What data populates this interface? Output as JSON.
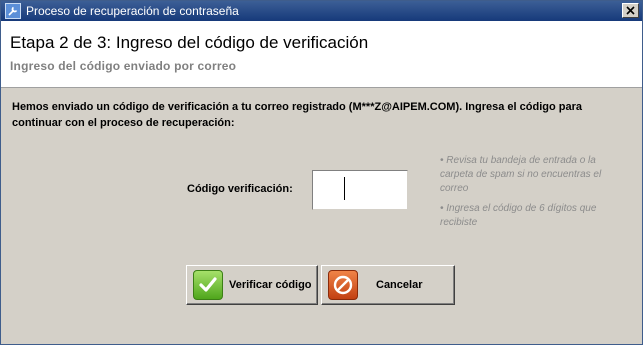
{
  "window": {
    "title": "Proceso de recuperación de contraseña",
    "icon": "wrench-icon"
  },
  "header": {
    "step_title": "Etapa 2 de 3: Ingreso del código de verificación",
    "subtitle": "Ingreso del código enviado por correo"
  },
  "body": {
    "message": "Hemos enviado un código de verificación a tu correo registrado (M***Z@AIPEM.COM). Ingresa el código para continuar con el proceso de recuperación:",
    "code_label": "Código verificación:",
    "code_value": "",
    "hints": [
      "• Revisa tu bandeja de entrada o la carpeta de spam si no encuentras el correo",
      "• Ingresa el código de 6 dígitos que recibiste"
    ]
  },
  "buttons": {
    "verify_label": "Verificar código",
    "verify_icon": "check-icon",
    "cancel_label": "Cancelar",
    "cancel_icon": "cancel-icon"
  },
  "colors": {
    "titlebar": "#16397a",
    "dialog_bg": "#d4d0c8",
    "hint_text": "#8c8c8c",
    "verify_icon": "#5cb82a",
    "cancel_icon": "#d9541f"
  }
}
